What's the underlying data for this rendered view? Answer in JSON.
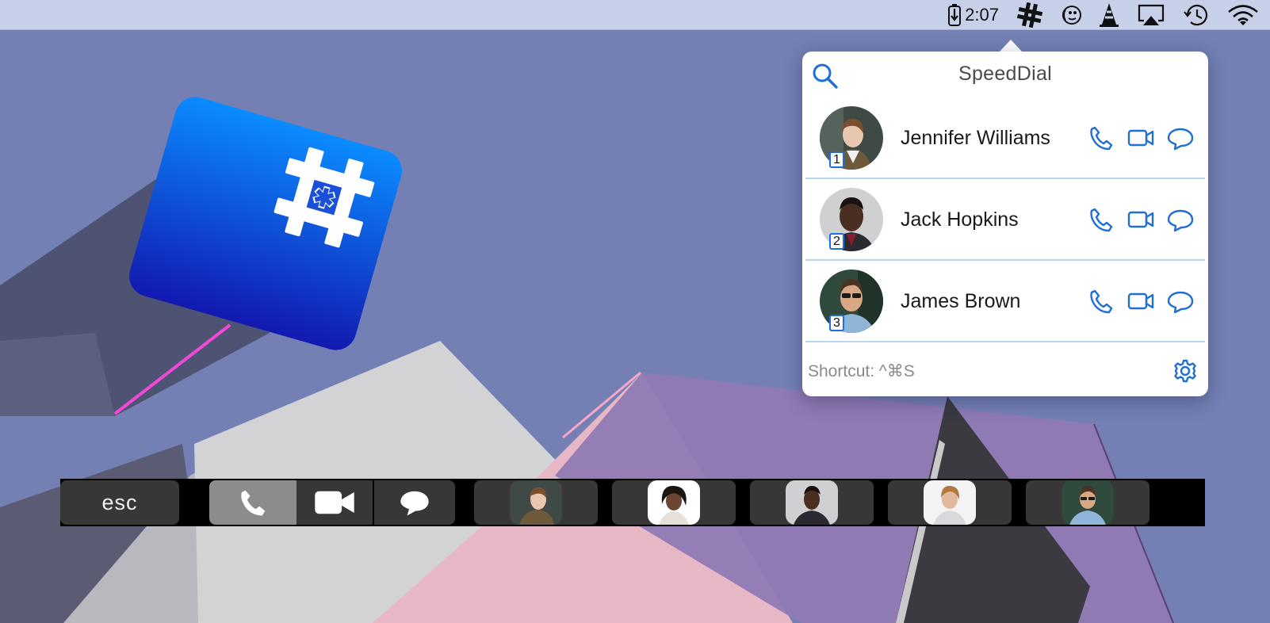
{
  "menubar": {
    "time": "2:07",
    "icons": [
      "battery-charging-icon",
      "speeddial-hash-icon",
      "faces-icon",
      "cone-icon",
      "airplay-icon",
      "time-machine-icon",
      "wifi-icon"
    ]
  },
  "popover": {
    "title": "SpeedDial",
    "shortcut": "Shortcut: ^⌘S",
    "contacts": [
      {
        "index": "1",
        "name": "Jennifer Williams"
      },
      {
        "index": "2",
        "name": "Jack Hopkins"
      },
      {
        "index": "3",
        "name": "James Brown"
      }
    ]
  },
  "touchbar": {
    "esc": "esc",
    "mode_buttons": [
      "phone-icon",
      "video-camera-icon",
      "speech-bubble-icon"
    ],
    "active_mode": "phone-icon",
    "favorites_count": 5
  },
  "colors": {
    "accent": "#1f6fd4",
    "menubar": "#c8cfe8",
    "desktop": "#7480b3",
    "app_icon_top": "#0b8cff",
    "app_icon_bottom": "#1219b0"
  }
}
